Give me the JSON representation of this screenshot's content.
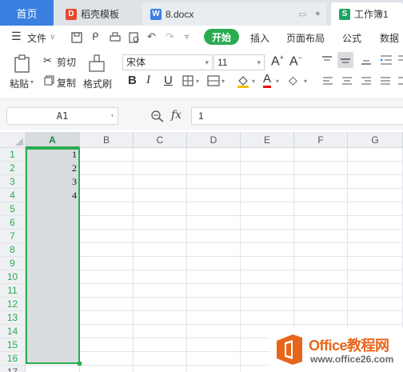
{
  "tabs": {
    "home": "首页",
    "daoke": "稻壳模板",
    "doc": "8.docx",
    "sheet": "工作簿1"
  },
  "menu": {
    "file": "文件",
    "start": "开始",
    "insert": "插入",
    "layout": "页面布局",
    "formula": "公式",
    "data": "数据"
  },
  "tools": {
    "paste": "粘贴",
    "cut": "剪切",
    "copy": "复制",
    "format_painter": "格式刷",
    "font_name": "宋体",
    "font_size": "11",
    "bold": "B",
    "italic": "I",
    "underline": "U"
  },
  "formula_bar": {
    "name_box": "A1",
    "fx": "fx",
    "value": "1"
  },
  "grid": {
    "columns": [
      "A",
      "B",
      "C",
      "D",
      "E",
      "F",
      "G"
    ],
    "rows": [
      "1",
      "2",
      "3",
      "4",
      "5",
      "6",
      "7",
      "8",
      "9",
      "10",
      "11",
      "12",
      "13",
      "14",
      "15",
      "16"
    ],
    "cells": [
      "1",
      "2",
      "3",
      "4"
    ],
    "next_row": "17"
  },
  "watermark": {
    "title": "Office教程网",
    "url": "www.office26.com"
  },
  "colors": {
    "accent": "#2bab51",
    "home_tab": "#3b7fe0",
    "watermark_orange": "#e8651c"
  }
}
